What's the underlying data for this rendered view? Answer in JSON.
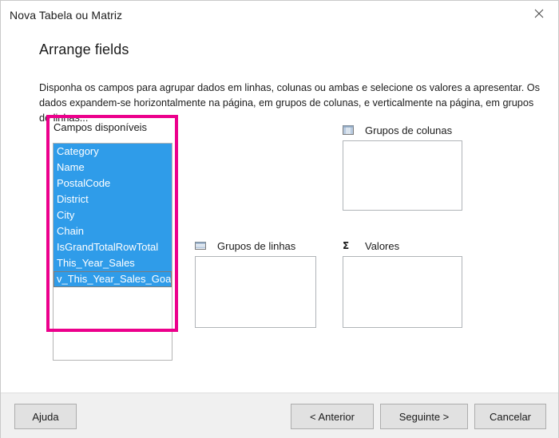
{
  "window": {
    "title": "Nova Tabela ou Matriz",
    "close_icon": "close-icon"
  },
  "wizard": {
    "heading": "Arrange fields",
    "description": "Disponha os campos para agrupar dados em linhas, colunas ou ambas e selecione os valores a apresentar. Os dados expandem-se horizontalmente na página, em grupos de colunas, e verticalmente na página, em grupos de linhas..."
  },
  "available_fields": {
    "label": "Campos disponíveis",
    "items": [
      {
        "label": "Category",
        "selected": true,
        "focused": false
      },
      {
        "label": "Name",
        "selected": true,
        "focused": false
      },
      {
        "label": "PostalCode",
        "selected": true,
        "focused": false
      },
      {
        "label": "District",
        "selected": true,
        "focused": false
      },
      {
        "label": "City",
        "selected": true,
        "focused": false
      },
      {
        "label": "Chain",
        "selected": true,
        "focused": false
      },
      {
        "label": "IsGrandTotalRowTotal",
        "selected": true,
        "focused": false
      },
      {
        "label": "This_Year_Sales",
        "selected": true,
        "focused": false
      },
      {
        "label": "v_This_Year_Sales_Goal",
        "selected": true,
        "focused": true
      }
    ]
  },
  "zones": {
    "column_groups": {
      "label": "Grupos de colunas",
      "icon": "column-groups-icon",
      "items": []
    },
    "row_groups": {
      "label": "Grupos de linhas",
      "icon": "row-groups-icon",
      "items": []
    },
    "values": {
      "label": "Valores",
      "icon": "sigma-icon",
      "glyph": "Σ",
      "items": []
    }
  },
  "footer": {
    "help": "Ajuda",
    "previous": "< Anterior",
    "next": "Seguinte >",
    "cancel": "Cancelar"
  },
  "colors": {
    "selection_blue": "#2f9ce9",
    "callout_magenta": "#ec008c",
    "footer_gray": "#f0f0f0",
    "button_face": "#e1e1e1"
  }
}
